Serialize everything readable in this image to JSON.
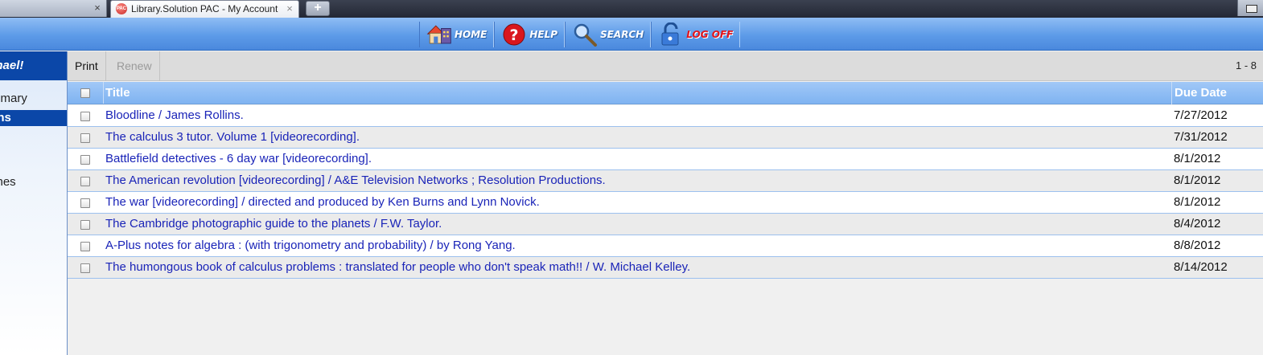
{
  "browser": {
    "tab_active_title": "Library.Solution PAC - My Account",
    "tab_favicon_text": "PAC",
    "close_glyph": "×",
    "new_tab_glyph": "+"
  },
  "nav": {
    "home": "HOME",
    "help": "HELP",
    "search": "SEARCH",
    "logoff": "LOG OFF"
  },
  "sidebar": {
    "greeting": "chael!",
    "items": [
      {
        "label": "mmary"
      },
      {
        "label": "ans"
      },
      {
        "label": "ches"
      }
    ]
  },
  "toolbar": {
    "print_label": "Print",
    "renew_label": "Renew",
    "range": "1 - 8"
  },
  "table": {
    "columns": {
      "title": "Title",
      "due_date": "Due Date"
    },
    "rows": [
      {
        "title": "Bloodline / James Rollins.",
        "due": "7/27/2012"
      },
      {
        "title": "The calculus 3 tutor. Volume 1 [videorecording].",
        "due": "7/31/2012"
      },
      {
        "title": "Battlefield detectives - 6 day war [videorecording].",
        "due": "8/1/2012"
      },
      {
        "title": "The American revolution [videorecording] / A&E Television Networks ; Resolution Productions.",
        "due": "8/1/2012"
      },
      {
        "title": "The war [videorecording] / directed and produced by Ken Burns and Lynn Novick.",
        "due": "8/1/2012"
      },
      {
        "title": "The Cambridge photographic guide to the planets / F.W. Taylor.",
        "due": "8/4/2012"
      },
      {
        "title": "A-Plus notes for algebra : (with trigonometry and probability) / by Rong Yang.",
        "due": "8/8/2012"
      },
      {
        "title": "The humongous book of calculus problems : translated for people who don't speak math!! / W. Michael Kelley.",
        "due": "8/14/2012"
      }
    ]
  },
  "colors": {
    "nav_blue": "#5d9be8",
    "sidebar_selected": "#0b47a8",
    "header_blue": "#7fb3f1",
    "link_blue": "#1a24b8",
    "logoff_red": "#e2161d"
  }
}
